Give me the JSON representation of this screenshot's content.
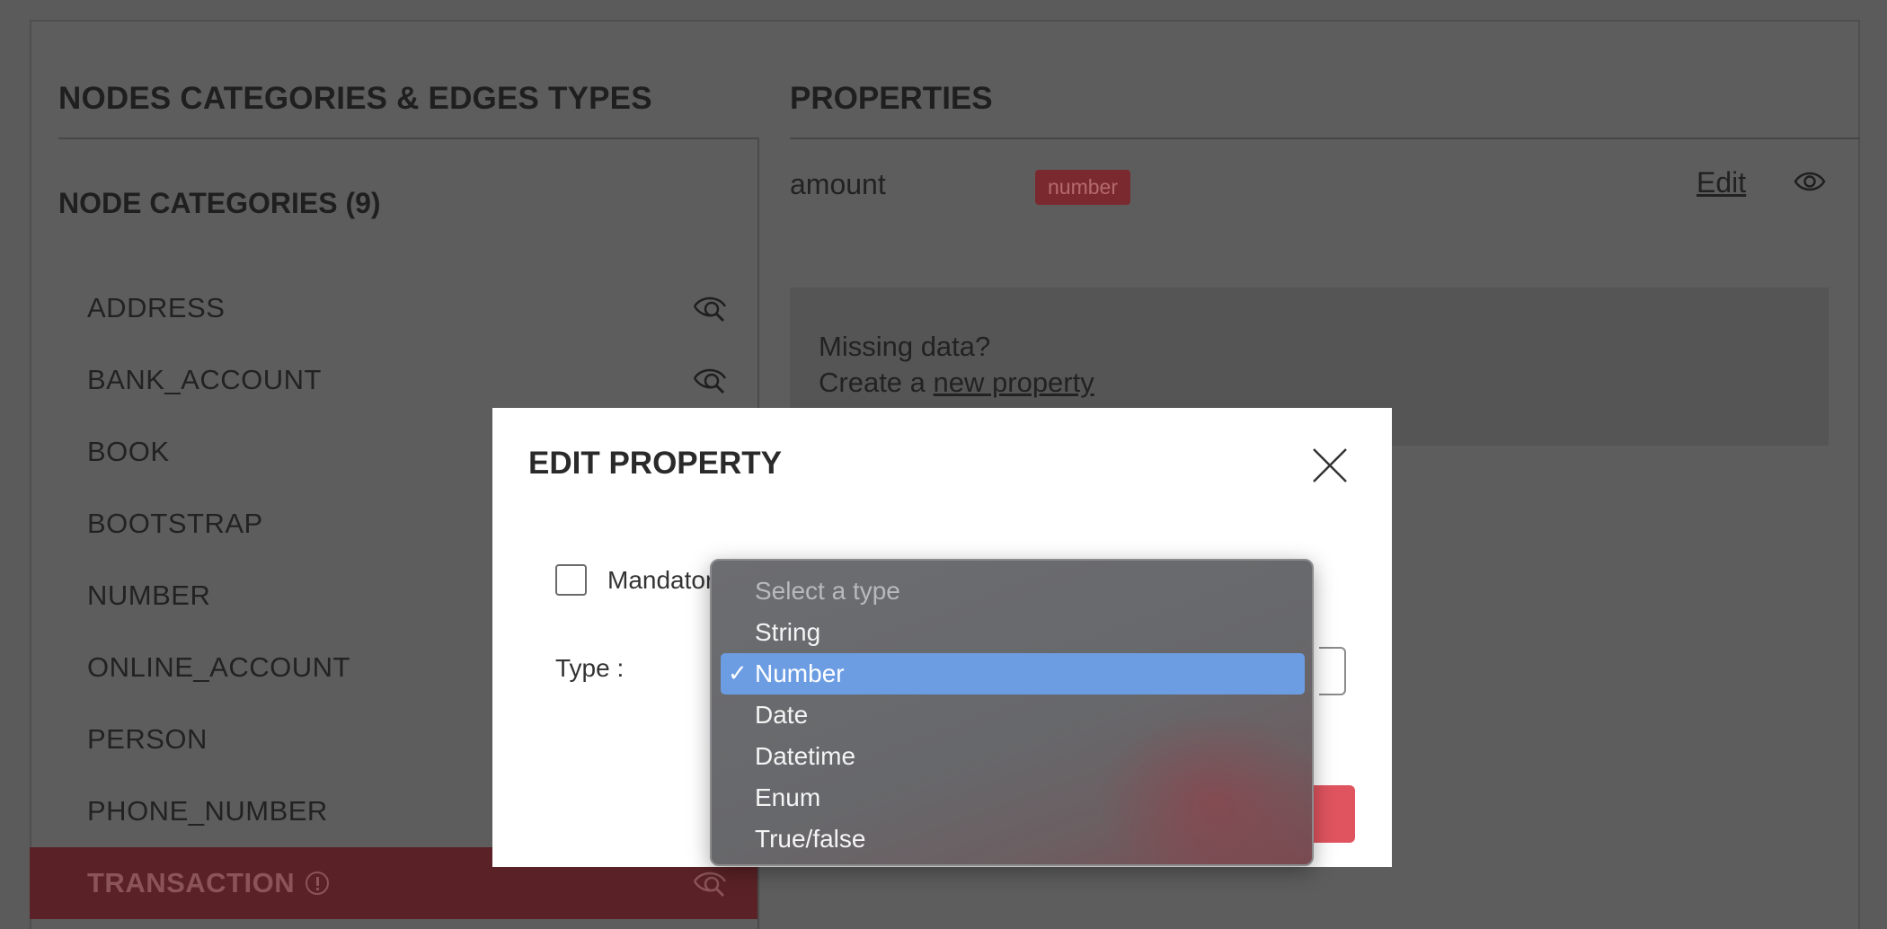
{
  "left_panel": {
    "title": "NODES CATEGORIES & EDGES TYPES",
    "node_heading": "NODE CATEGORIES (9)",
    "nodes": [
      {
        "label": "ADDRESS",
        "visible_icon": "eye-hidden-icon"
      },
      {
        "label": "BANK_ACCOUNT",
        "visible_icon": "eye-hidden-icon"
      },
      {
        "label": "BOOK"
      },
      {
        "label": "BOOTSTRAP"
      },
      {
        "label": "NUMBER"
      },
      {
        "label": "ONLINE_ACCOUNT"
      },
      {
        "label": "PERSON"
      },
      {
        "label": "PHONE_NUMBER"
      },
      {
        "label": "TRANSACTION",
        "active": true,
        "visible_icon": "eye-hidden-icon"
      }
    ]
  },
  "right_panel": {
    "title": "PROPERTIES",
    "property": {
      "name": "amount",
      "type_badge": "number",
      "edit_label": "Edit"
    },
    "missing": {
      "line1": "Missing data?",
      "line2_prefix": "Create a",
      "link": "new property"
    }
  },
  "modal": {
    "title": "EDIT PROPERTY",
    "mandatory_label": "Mandatory",
    "type_label": "Type :",
    "dropdown": {
      "placeholder": "Select a type",
      "selected": "Number",
      "options": [
        "String",
        "Number",
        "Date",
        "Datetime",
        "Enum",
        "True/false"
      ]
    }
  },
  "colors": {
    "active_row": "#5a2226",
    "badge": "#7a2a2e",
    "selected_option": "#6c9de3",
    "primary_button": "#e0545f"
  }
}
